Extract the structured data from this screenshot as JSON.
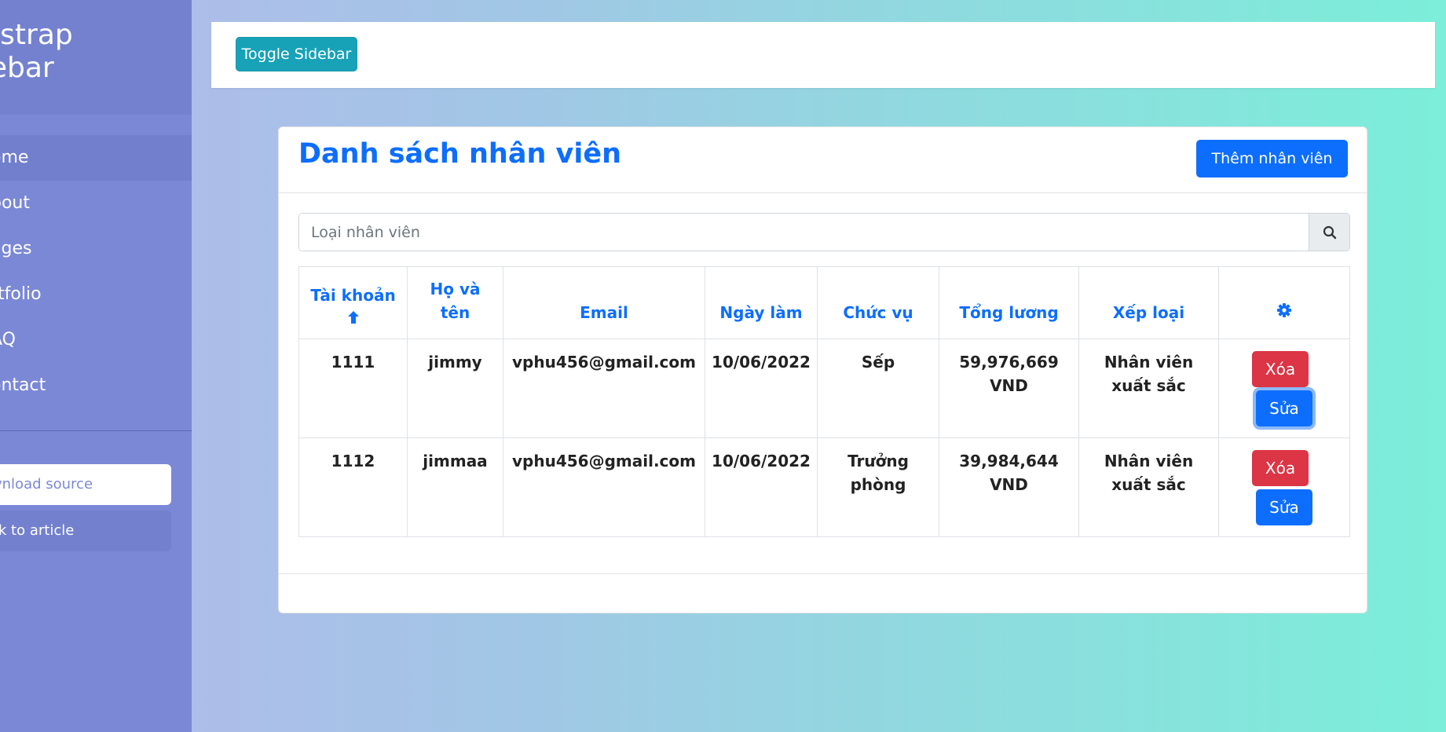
{
  "sidebar": {
    "title_line1": "otstrap",
    "title_line2": "debar",
    "items": [
      {
        "label": "ome"
      },
      {
        "label": "bout"
      },
      {
        "label": "ages"
      },
      {
        "label": "rtfolio"
      },
      {
        "label": "AQ"
      },
      {
        "label": "ontact"
      }
    ],
    "download_label": "vnload source",
    "article_label": "ck to article"
  },
  "topbar": {
    "toggle_label": "Toggle Sidebar"
  },
  "card": {
    "title": "Danh sách nhân viên",
    "add_label": "Thêm nhân viên",
    "search_placeholder": "Loại nhân viên",
    "columns": [
      "Tài khoản",
      "Họ và tên",
      "Email",
      "Ngày làm",
      "Chức vụ",
      "Tổng lương",
      "Xếp loại"
    ],
    "sort_icon": "arrow-up-icon",
    "settings_icon": "gear-icon",
    "rows": [
      {
        "account": "1111",
        "name": "jimmy",
        "email": "vphu456@gmail.com",
        "date": "10/06/2022",
        "role": "Sếp",
        "salary": "59,976,669 VND",
        "rank": "Nhân viên xuất sắc",
        "delete": "Xóa",
        "edit": "Sửa"
      },
      {
        "account": "1112",
        "name": "jimmaa",
        "email": "vphu456@gmail.com",
        "date": "10/06/2022",
        "role": "Trưởng phòng",
        "salary": "39,984,644 VND",
        "rank": "Nhân viên xuất sắc",
        "delete": "Xóa",
        "edit": "Sửa"
      }
    ]
  },
  "colors": {
    "primary": "#0d6efd",
    "danger": "#dc3545",
    "info": "#17a2b8",
    "sidebar": "#7b88d6"
  }
}
